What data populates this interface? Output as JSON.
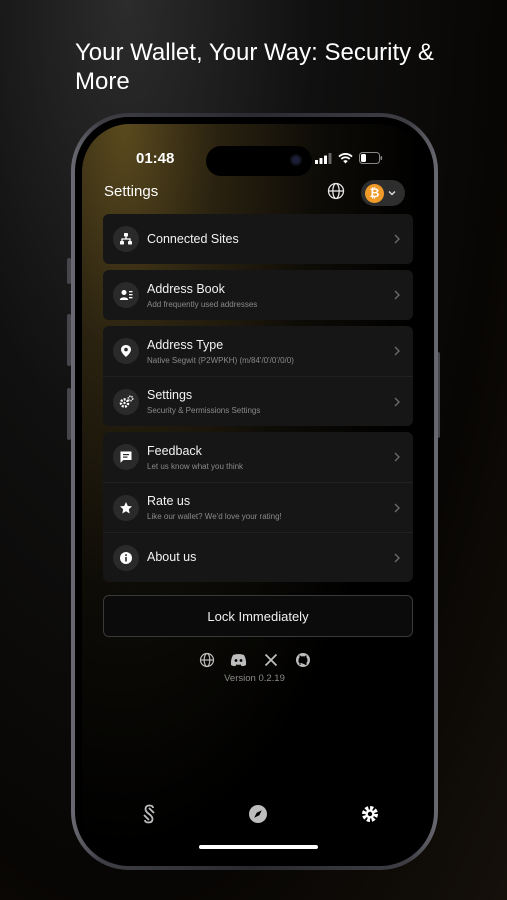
{
  "headline": "Your Wallet, Your Way: Security & More",
  "status_bar": {
    "time": "01:48"
  },
  "header": {
    "title": "Settings",
    "account_icon": "bitcoin-icon",
    "account_symbol": "₿"
  },
  "groups": [
    {
      "items": [
        {
          "label": "Connected Sites",
          "subtitle": "",
          "icon": "sitemap-icon"
        }
      ]
    },
    {
      "items": [
        {
          "label": "Address Book",
          "subtitle": "Add frequently used addresses",
          "icon": "contacts-icon"
        }
      ]
    },
    {
      "items": [
        {
          "label": "Address Type",
          "subtitle": "Native Segwit (P2WPKH) (m/84'/0'/0'/0/0)",
          "icon": "location-pin-icon"
        },
        {
          "label": "Settings",
          "subtitle": "Security & Permissions Settings",
          "icon": "gears-icon"
        }
      ]
    },
    {
      "items": [
        {
          "label": "Feedback",
          "subtitle": "Let us know what you think",
          "icon": "message-icon"
        },
        {
          "label": "Rate us",
          "subtitle": "Like our wallet? We'd love your rating!",
          "icon": "star-icon"
        },
        {
          "label": "About us",
          "subtitle": "",
          "icon": "info-icon"
        }
      ]
    }
  ],
  "lock_button": "Lock Immediately",
  "socials": [
    "globe-icon",
    "discord-icon",
    "x-icon",
    "github-icon"
  ],
  "version": "Version 0.2.19",
  "tabbar": [
    "wallet-tab-icon",
    "explore-compass-icon",
    "settings-gear-icon"
  ],
  "colors": {
    "accent": "#f09a2a",
    "background": "#000000",
    "card": "#161616"
  }
}
